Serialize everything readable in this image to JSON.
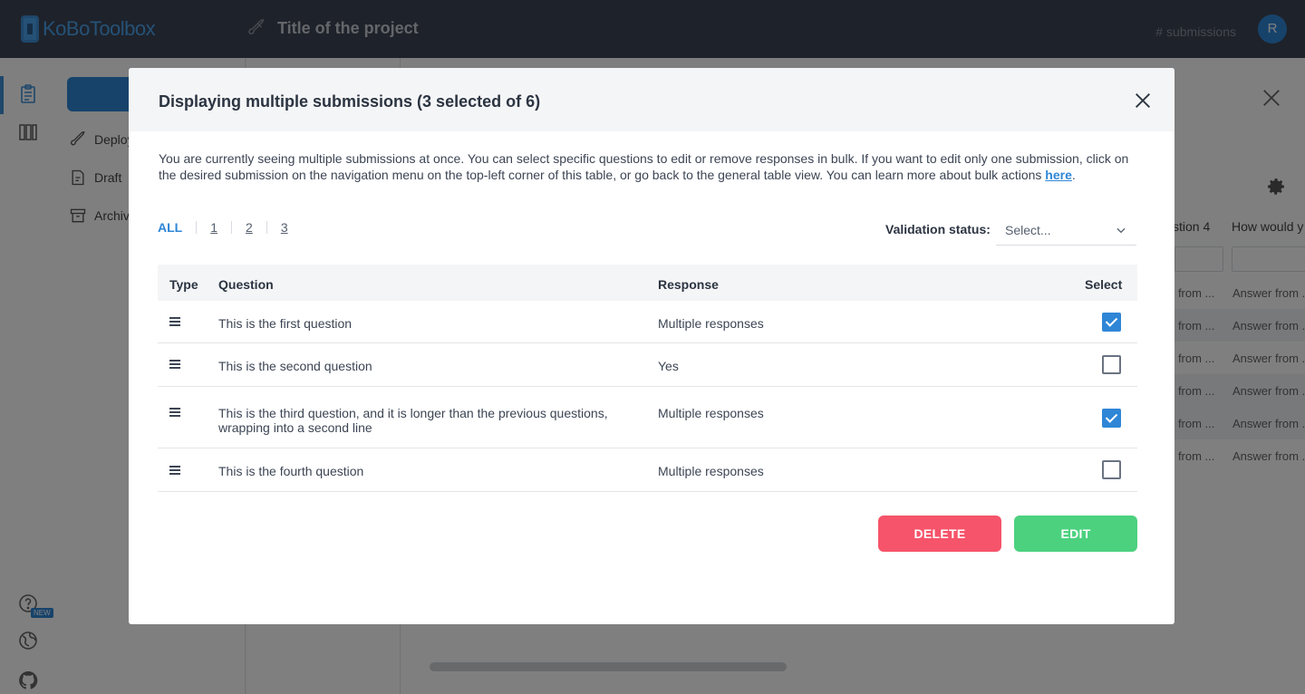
{
  "app": {
    "logo_text": "KoBoToolbox",
    "project_title": "Title of the project",
    "submissions_label": "# submissions",
    "avatar_initial": "R",
    "new_badge": "NEW"
  },
  "sidebar": {
    "items": [
      {
        "label": "Deploy"
      },
      {
        "label": "Draft"
      },
      {
        "label": "Archiv"
      }
    ]
  },
  "background_table": {
    "columns": [
      "stion 4",
      "How would y"
    ],
    "cells": [
      "r from ...",
      "Answer from ."
    ]
  },
  "modal": {
    "title": "Displaying multiple submissions (3 selected of 6)",
    "intro_text": "You are currently seeing multiple submissions at once. You can select specific questions to edit or remove responses in bulk. If you want to edit only one submission, click on the desired submission on the navigation menu on the top-left corner of this table, or go back to the general table view. You can learn more about bulk actions ",
    "intro_link": "here",
    "intro_end": ".",
    "tabs": [
      "ALL",
      "1",
      "2",
      "3"
    ],
    "validation_label": "Validation status:",
    "validation_placeholder": "Select...",
    "table": {
      "headers": {
        "type": "Type",
        "question": "Question",
        "response": "Response",
        "select": "Select"
      },
      "rows": [
        {
          "question": "This is the first question",
          "response": "Multiple responses",
          "selected": true
        },
        {
          "question": "This is the second question",
          "response": "Yes",
          "selected": false
        },
        {
          "question": "This is the third question, and it is longer than the previous questions, wrapping into a second line",
          "response": "Multiple responses",
          "selected": true
        },
        {
          "question": "This is the fourth question",
          "response": "Multiple responses",
          "selected": false
        }
      ]
    },
    "delete_label": "DELETE",
    "edit_label": "EDIT"
  },
  "colors": {
    "accent": "#2f86d6",
    "delete": "#f6546a",
    "edit": "#4cd17f",
    "topbar": "#3d4554"
  }
}
